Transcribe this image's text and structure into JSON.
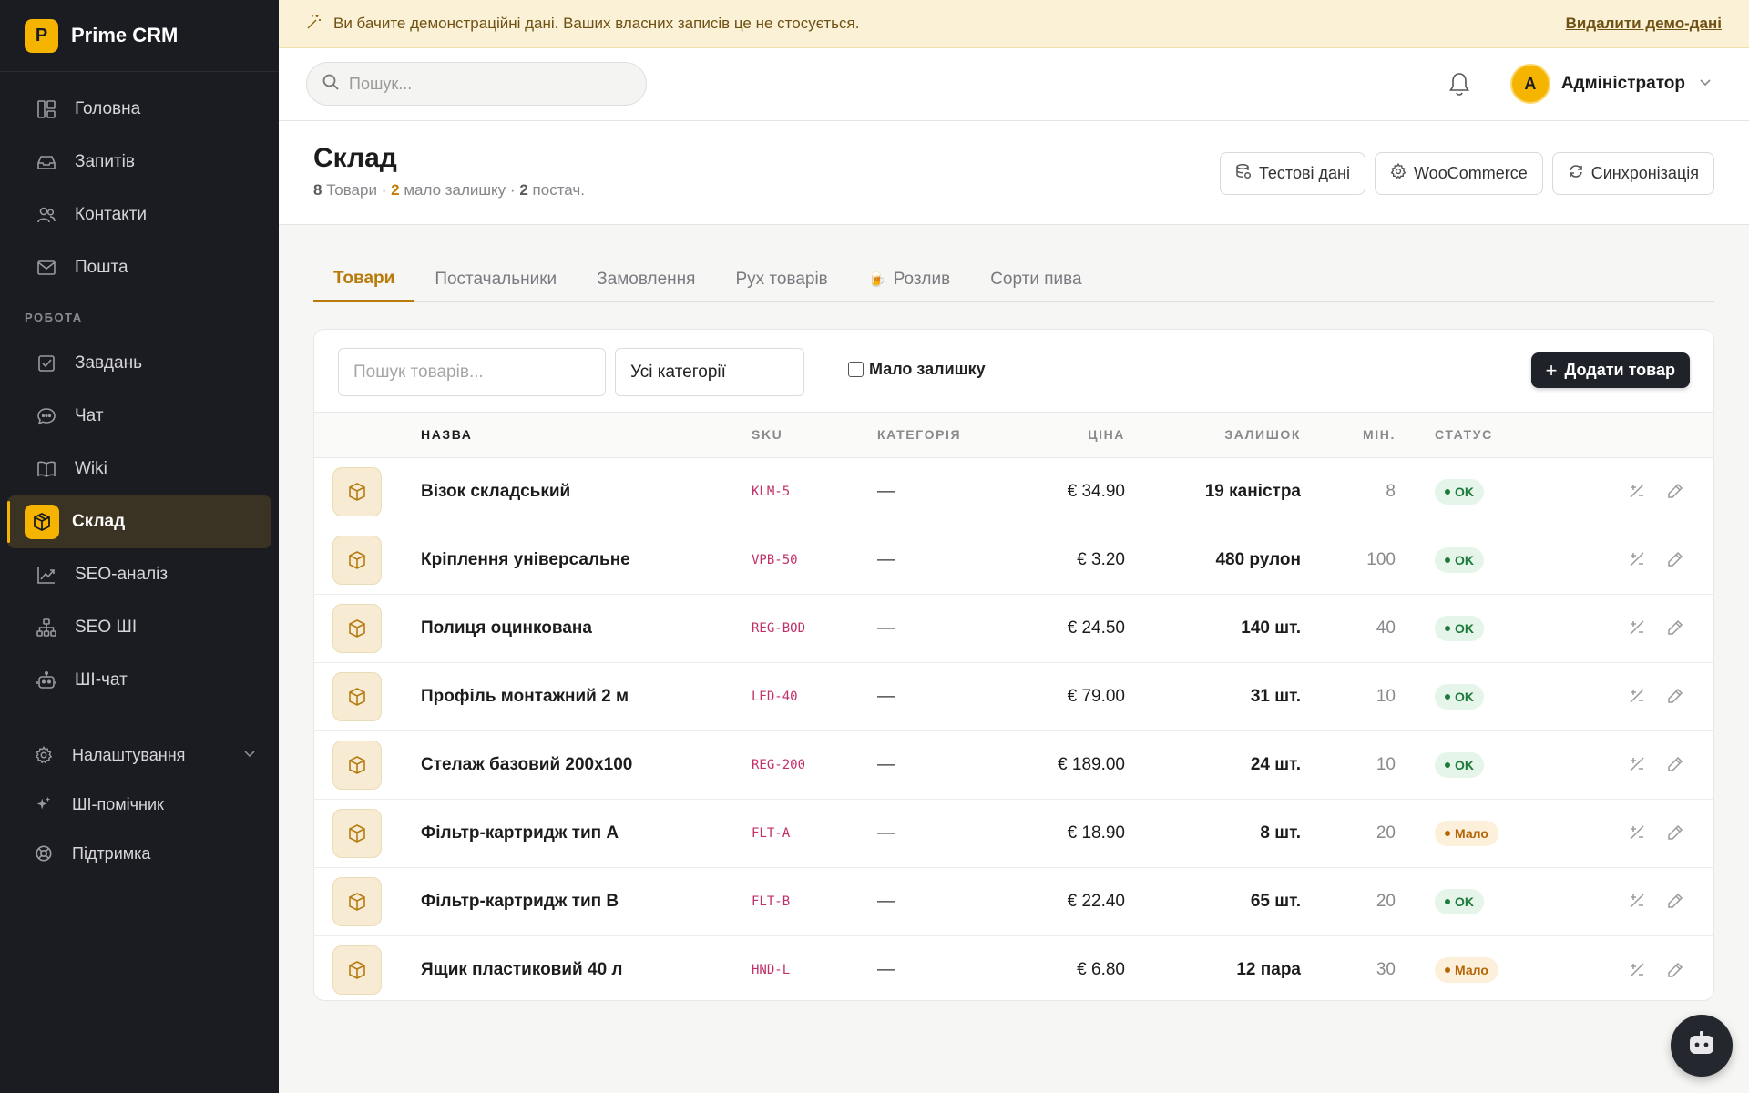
{
  "app": {
    "logo_letter": "P",
    "name": "Prime CRM"
  },
  "sidebar": {
    "main_items": [
      {
        "label": "Головна",
        "icon": "dashboard-icon"
      },
      {
        "label": "Запитів",
        "icon": "inbox-icon"
      },
      {
        "label": "Контакти",
        "icon": "users-icon"
      },
      {
        "label": "Пошта",
        "icon": "mail-icon"
      }
    ],
    "section_work": "РОБОТА",
    "work_items": [
      {
        "label": "Завдань",
        "icon": "checkbox-icon"
      },
      {
        "label": "Чат",
        "icon": "chat-icon"
      },
      {
        "label": "Wiki",
        "icon": "book-icon"
      },
      {
        "label": "Склад",
        "icon": "package-icon",
        "active": true
      },
      {
        "label": "SEO-аналіз",
        "icon": "chart-icon"
      },
      {
        "label": "SEO ШІ",
        "icon": "sitemap-icon"
      },
      {
        "label": "ШІ-чат",
        "icon": "robot-icon"
      }
    ],
    "bottom_items": [
      {
        "label": "Налаштування",
        "icon": "gear-icon"
      },
      {
        "label": "ШІ-помічник",
        "icon": "sparkle-icon"
      },
      {
        "label": "Підтримка",
        "icon": "lifebuoy-icon"
      }
    ]
  },
  "banner": {
    "text": "Ви бачите демонстраційні дані. Ваших власних записів це не стосується.",
    "link": "Видалити демо-дані"
  },
  "topbar": {
    "search_placeholder": "Пошук...",
    "user_initial": "A",
    "user_name": "Адміністратор"
  },
  "page": {
    "title": "Склад",
    "sub": {
      "products_count": "8",
      "products_label": "Товари",
      "low_count": "2",
      "low_label": "мало залишку",
      "suppliers_count": "2",
      "suppliers_label": "постач.",
      "sep": "·"
    },
    "buttons": {
      "test_data": "Тестові дані",
      "woocommerce": "WooCommerce",
      "sync": "Синхронізація"
    }
  },
  "tabs": [
    {
      "label": "Товари",
      "active": true
    },
    {
      "label": "Постачальники"
    },
    {
      "label": "Замовлення"
    },
    {
      "label": "Рух товарів"
    },
    {
      "label": "Розлив",
      "emoji": "🍺"
    },
    {
      "label": "Сорти пива"
    }
  ],
  "filters": {
    "search_placeholder": "Пошук товарів...",
    "category_value": "Усі категорії",
    "low_stock_label": "Мало залишку",
    "add_button": "Додати товар"
  },
  "table": {
    "headers": {
      "name": "НАЗВА",
      "sku": "SKU",
      "category": "КАТЕГОРІЯ",
      "price": "ЦІНА",
      "stock": "ЗАЛИШОК",
      "min": "МІН.",
      "status": "СТАТУС"
    },
    "rows": [
      {
        "name": "Візок складський",
        "sku": "KLM-5",
        "category": "—",
        "price": "€ 34.90",
        "stock": "19 каністра",
        "min": "8",
        "status": "OK",
        "status_type": "ok"
      },
      {
        "name": "Кріплення універсальне",
        "sku": "VPB-50",
        "category": "—",
        "price": "€ 3.20",
        "stock": "480 рулон",
        "min": "100",
        "status": "OK",
        "status_type": "ok"
      },
      {
        "name": "Полиця оцинкована",
        "sku": "REG-BOD",
        "category": "—",
        "price": "€ 24.50",
        "stock": "140 шт.",
        "min": "40",
        "status": "OK",
        "status_type": "ok"
      },
      {
        "name": "Профіль монтажний 2 м",
        "sku": "LED-40",
        "category": "—",
        "price": "€ 79.00",
        "stock": "31 шт.",
        "min": "10",
        "status": "OK",
        "status_type": "ok"
      },
      {
        "name": "Стелаж базовий 200x100",
        "sku": "REG-200",
        "category": "—",
        "price": "€ 189.00",
        "stock": "24 шт.",
        "min": "10",
        "status": "OK",
        "status_type": "ok"
      },
      {
        "name": "Фільтр-картридж тип A",
        "sku": "FLT-A",
        "category": "—",
        "price": "€ 18.90",
        "stock": "8 шт.",
        "min": "20",
        "status": "Мало",
        "status_type": "low"
      },
      {
        "name": "Фільтр-картридж тип B",
        "sku": "FLT-B",
        "category": "—",
        "price": "€ 22.40",
        "stock": "65 шт.",
        "min": "20",
        "status": "OK",
        "status_type": "ok"
      },
      {
        "name": "Ящик пластиковий 40 л",
        "sku": "HND-L",
        "category": "—",
        "price": "€ 6.80",
        "stock": "12 пара",
        "min": "30",
        "status": "Мало",
        "status_type": "low"
      }
    ]
  },
  "colors": {
    "accent": "#f5b400",
    "tab_active": "#b97a0b",
    "sidebar_bg": "#1b1c22",
    "ok": "#1d7a3a",
    "low": "#b56506",
    "sku": "#c0306a"
  }
}
